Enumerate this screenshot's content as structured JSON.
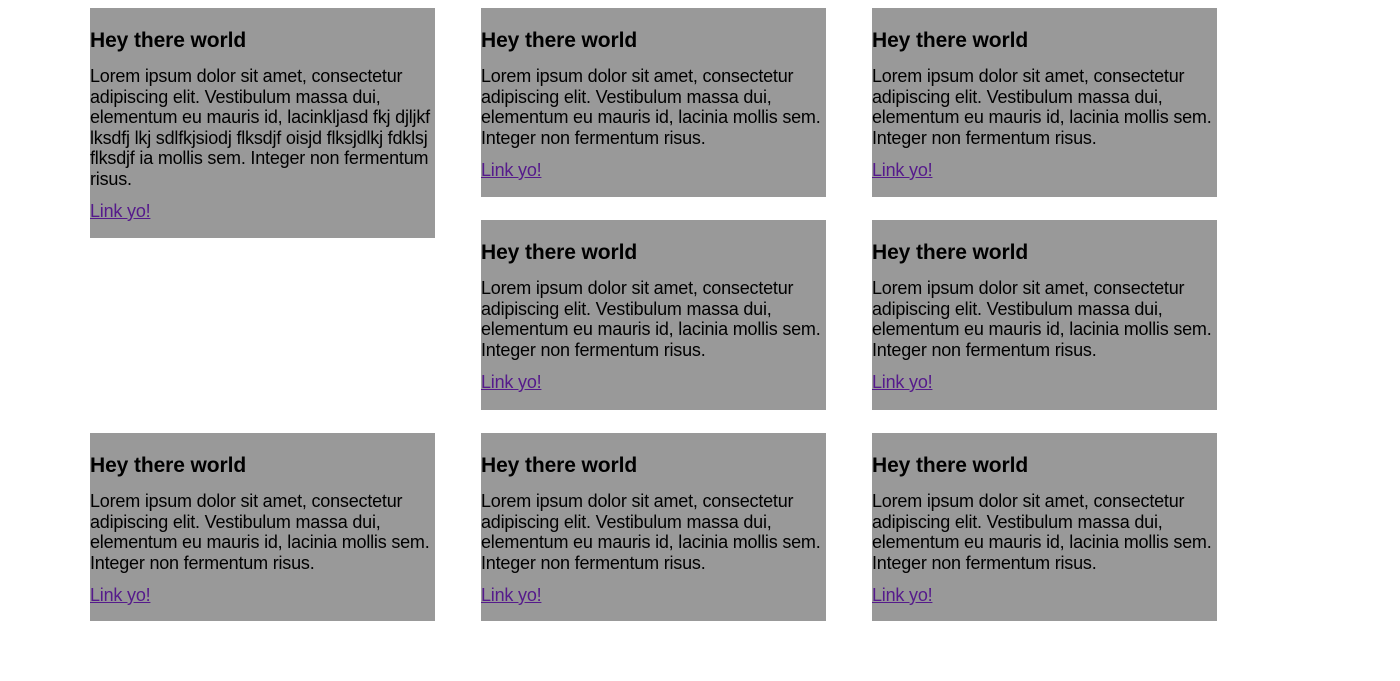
{
  "cards": [
    {
      "heading": "Hey there world",
      "body": "Lorem ipsum dolor sit amet, consectetur adipiscing elit. Vestibulum massa dui, elementum eu mauris id, lacinkljasd fkj djljkf lksdfj lkj sdlfkjsiodj flksdjf oisjd flksjdlkj fdklsj flksdjf ia mollis sem. Integer non fermentum risus.",
      "link": "Link yo!"
    },
    {
      "heading": "Hey there world",
      "body": "Lorem ipsum dolor sit amet, consectetur adipiscing elit. Vestibulum massa dui, elementum eu mauris id, lacinia mollis sem. Integer non fermentum risus.",
      "link": "Link yo!"
    },
    {
      "heading": "Hey there world",
      "body": "Lorem ipsum dolor sit amet, consectetur adipiscing elit. Vestibulum massa dui, elementum eu mauris id, lacinia mollis sem. Integer non fermentum risus.",
      "link": "Link yo!"
    },
    {
      "heading": "Hey there world",
      "body": "Lorem ipsum dolor sit amet, consectetur adipiscing elit. Vestibulum massa dui, elementum eu mauris id, lacinia mollis sem. Integer non fermentum risus.",
      "link": "Link yo!"
    },
    {
      "heading": "Hey there world",
      "body": "Lorem ipsum dolor sit amet, consectetur adipiscing elit. Vestibulum massa dui, elementum eu mauris id, lacinia mollis sem. Integer non fermentum risus.",
      "link": "Link yo!"
    },
    {
      "heading": "Hey there world",
      "body": "Lorem ipsum dolor sit amet, consectetur adipiscing elit. Vestibulum massa dui, elementum eu mauris id, lacinia mollis sem. Integer non fermentum risus.",
      "link": "Link yo!"
    },
    {
      "heading": "Hey there world",
      "body": "Lorem ipsum dolor sit amet, consectetur adipiscing elit. Vestibulum massa dui, elementum eu mauris id, lacinia mollis sem. Integer non fermentum risus.",
      "link": "Link yo!"
    },
    {
      "heading": "Hey there world",
      "body": "Lorem ipsum dolor sit amet, consectetur adipiscing elit. Vestibulum massa dui, elementum eu mauris id, lacinia mollis sem. Integer non fermentum risus.",
      "link": "Link yo!"
    }
  ],
  "colors": {
    "card_background": "#999999",
    "page_background": "#ffffff",
    "text": "#000000",
    "link_visited": "#551a8b"
  }
}
